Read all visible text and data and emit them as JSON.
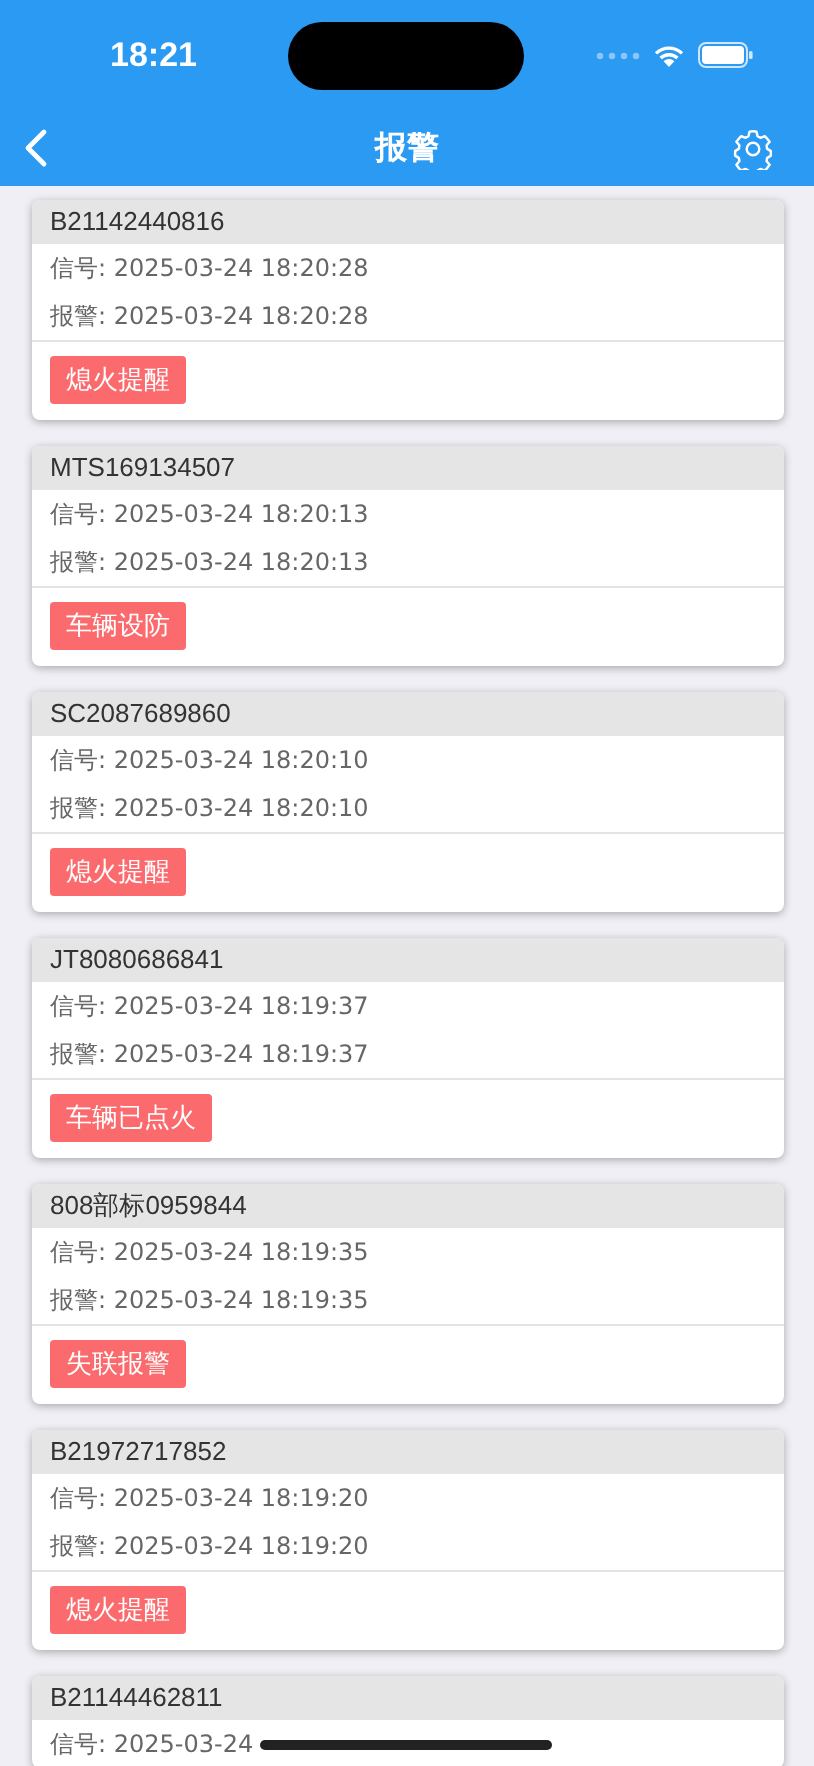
{
  "status_bar": {
    "time": "18:21"
  },
  "nav": {
    "title": "报警"
  },
  "cards": [
    {
      "id": "B21142440816",
      "signal_label": "信号:",
      "signal": "2025-03-24 18:20:28",
      "alarm_label": "报警:",
      "alarm": "2025-03-24 18:20:28",
      "tag": "熄火提醒"
    },
    {
      "id": "MTS169134507",
      "signal_label": "信号:",
      "signal": "2025-03-24 18:20:13",
      "alarm_label": "报警:",
      "alarm": "2025-03-24 18:20:13",
      "tag": "车辆设防"
    },
    {
      "id": "SC2087689860",
      "signal_label": "信号:",
      "signal": "2025-03-24 18:20:10",
      "alarm_label": "报警:",
      "alarm": "2025-03-24 18:20:10",
      "tag": "熄火提醒"
    },
    {
      "id": "JT8080686841",
      "signal_label": "信号:",
      "signal": "2025-03-24 18:19:37",
      "alarm_label": "报警:",
      "alarm": "2025-03-24 18:19:37",
      "tag": "车辆已点火"
    },
    {
      "id": "808部标0959844",
      "signal_label": "信号:",
      "signal": "2025-03-24 18:19:35",
      "alarm_label": "报警:",
      "alarm": "2025-03-24 18:19:35",
      "tag": "失联报警"
    },
    {
      "id": "B21972717852",
      "signal_label": "信号:",
      "signal": "2025-03-24 18:19:20",
      "alarm_label": "报警:",
      "alarm": "2025-03-24 18:19:20",
      "tag": "熄火提醒"
    },
    {
      "id": "B21144462811",
      "signal_label": "信号:",
      "signal": "2025-03-24"
    }
  ]
}
